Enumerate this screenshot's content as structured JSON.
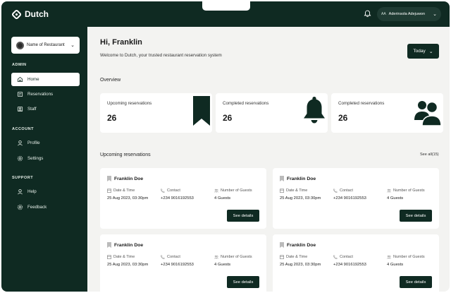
{
  "brand": {
    "name": "Dutch"
  },
  "header": {
    "user_initials": "AA",
    "user_name": "Aderinsola Adejuwon"
  },
  "sidebar": {
    "restaurant_select": "Name of Restaurant",
    "sections": [
      {
        "title": "ADMIN",
        "items": [
          {
            "label": "Home",
            "icon": "home-icon",
            "active": true
          },
          {
            "label": "Reservations",
            "icon": "reservations-icon"
          },
          {
            "label": "Staff",
            "icon": "staff-icon"
          }
        ]
      },
      {
        "title": "ACCOUNT",
        "items": [
          {
            "label": "Profile",
            "icon": "profile-icon"
          },
          {
            "label": "Settings",
            "icon": "gear-icon"
          }
        ]
      },
      {
        "title": "SUPPORT",
        "items": [
          {
            "label": "Help",
            "icon": "help-icon"
          },
          {
            "label": "Feedback",
            "icon": "feedback-icon"
          }
        ]
      }
    ]
  },
  "main": {
    "greeting": "Hi, Franklin",
    "welcome": "Welcome to Dutch, your trusted restaurant reservation system",
    "period_button": "Today",
    "overview_title": "Overview",
    "stats": [
      {
        "label": "Upcoming reservations",
        "value": "26",
        "icon": "bookmark-icon"
      },
      {
        "label": "Completed reservations",
        "value": "26",
        "icon": "bell-icon"
      },
      {
        "label": "Completed reservations",
        "value": "26",
        "icon": "guests-icon"
      }
    ],
    "upcoming_title": "Upcoming reservations",
    "see_all": "See all(15)",
    "reservations": [
      {
        "name": "Franklin Doe",
        "date_label": "Date & Time",
        "date": "25 Aug 2023, 03:30pm",
        "contact_label": "Contact",
        "contact": "+234 9016192553",
        "guests_label": "Number of Guests",
        "guests": "4 Guests",
        "button": "See details"
      },
      {
        "name": "Franklin Doe",
        "date_label": "Date & Time",
        "date": "25 Aug 2023, 03:30pm",
        "contact_label": "Contact",
        "contact": "+234 9016192553",
        "guests_label": "Number of Guests",
        "guests": "4 Guests",
        "button": "See details"
      },
      {
        "name": "Franklin Doe",
        "date_label": "Date & Time",
        "date": "25 Aug 2023, 03:30pm",
        "contact_label": "Contact",
        "contact": "+234 9016192553",
        "guests_label": "Number of Guests",
        "guests": "4 Guests",
        "button": "See details"
      },
      {
        "name": "Franklin Doe",
        "date_label": "Date & Time",
        "date": "25 Aug 2023, 03:30pm",
        "contact_label": "Contact",
        "contact": "+234 9016192553",
        "guests_label": "Number of Guests",
        "guests": "4 Guests",
        "button": "See details"
      }
    ]
  },
  "colors": {
    "primary": "#0f2a22",
    "background": "#f3f3f1",
    "card": "#ffffff"
  }
}
